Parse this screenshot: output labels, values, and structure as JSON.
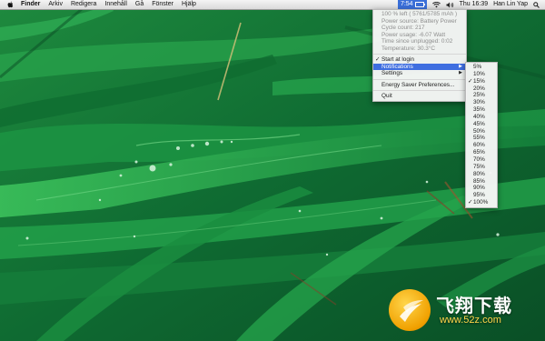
{
  "menubar": {
    "app_name": "Finder",
    "menus": [
      "Arkiv",
      "Redigera",
      "Innehåll",
      "Gå",
      "Fönster",
      "Hjälp"
    ],
    "battery_time": "7:54",
    "clock": "Thu 16:39",
    "user": "Han Lin Yap",
    "icons": [
      "apple-icon",
      "battery-icon",
      "wifi-icon",
      "volume-icon",
      "spotlight-icon"
    ]
  },
  "battery_menu": {
    "info_rows": [
      "100 % left ( 5761/5785 mAh )",
      "Power source: Battery Power",
      "Cycle count: 217",
      "Power usage: -6.07 Watt",
      "Time since unplugged: 0:02",
      "Temperature: 30.3°C"
    ],
    "start_at_login": "Start at login",
    "notifications": "Notifications",
    "settings": "Settings",
    "energy_saver": "Energy Saver Preferences...",
    "quit": "Quit"
  },
  "notifications_submenu": {
    "items": [
      "5%",
      "10%",
      "15%",
      "20%",
      "25%",
      "30%",
      "35%",
      "40%",
      "45%",
      "50%",
      "55%",
      "60%",
      "65%",
      "70%",
      "75%",
      "80%",
      "85%",
      "90%",
      "95%",
      "100%"
    ],
    "checked": [
      "15%",
      "100%"
    ]
  },
  "watermark": {
    "brand": "飞翔下载",
    "url": "www.52z.com"
  },
  "colors": {
    "menu_highlight": "#3f6ee0",
    "wallpaper_dark": "#0c5a2c",
    "wallpaper_light": "#2fb04f"
  }
}
